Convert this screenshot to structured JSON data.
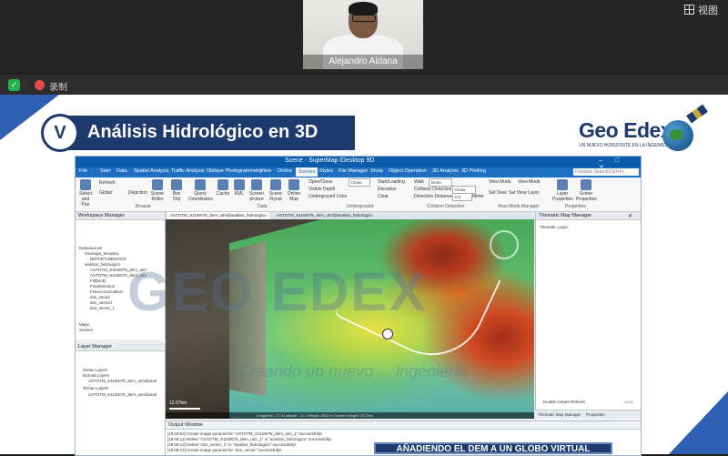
{
  "meeting": {
    "participant_name": "Alejandro Aldana",
    "view_label": "视图",
    "record_label": "录制"
  },
  "slide": {
    "badge": "V",
    "title": "Análisis Hidrológico en 3D",
    "logo": "Geo Edex",
    "tagline": "UN NUEVO HORIZONTE EN LA INGENIERÍA",
    "watermark_logo": "GEO EDEX",
    "watermark_text": "Creando un nuevo ... ingeniería",
    "banner": "AÑADIENDO EL DEM A UN GLOBO VIRTUAL"
  },
  "app": {
    "title": "Scene - SuperMap iDesktop 9D",
    "window_controls": "–  □  ✕",
    "menu": [
      "File",
      "Start",
      "Data",
      "Spatial Analysis",
      "Traffic Analysis",
      "Oblique Photogrammetry",
      "View",
      "Online",
      "Scenes",
      "Styles",
      "File Manager",
      "Show",
      "Object Operation",
      "3D Analysis",
      "3D Plotting"
    ],
    "active_menu_index": 8,
    "search_placeholder": "Function Search(Ctrl+F)",
    "ribbon": {
      "buttons": [
        "Select and Pan",
        "Refresh",
        "Global",
        "Depiction",
        "Scene Roller",
        "Box Clip",
        "Query Coordinates",
        "Cache",
        "KML",
        "Screen picture",
        "Scene Flyout",
        "Online Map",
        "Layer Properties",
        "Scene Properties"
      ],
      "small": [
        "Open/Close",
        "Visible Depth",
        "Underground Color",
        "Start/Loading",
        "Elevation",
        "Clear",
        "Walk",
        "Collision Detection",
        "Detection Distance",
        "View Mode",
        "Set View",
        "View Mode",
        "Set View Layer"
      ],
      "selects": [
        "Close",
        "Close",
        "None",
        "Close",
        "0.5"
      ],
      "groups": [
        "Browse",
        "Data",
        "Underground",
        "Collision Detection",
        "View Mode Manager",
        "Properties"
      ],
      "unit": "Meter"
    },
    "workspace": {
      "header": "Workspace Manager",
      "items": [
        "Datasources",
        "Geologia_tematica",
        "DEPARTAMENTOS",
        "analisis_hidrologico",
        "ASTGTM_S11W078_dem_utm",
        "ASTGTM_S11W078_dem_utm",
        "Fill(Sink)",
        "FlowDirection",
        "FlowAccumulation",
        "dos_vector",
        "dos_vector1",
        "dos_vector_1",
        "Maps",
        "Scenes"
      ]
    },
    "layer_manager": {
      "header": "Layer Manager",
      "items": [
        "Scene Layers",
        "Normal Layers",
        "ASTGTM_S11W078_dem_utm@anal",
        "Terrain Layers",
        "ASTGTM_S11W078_dem_utm@anal"
      ]
    },
    "map_tabs": [
      "ASTGTM_S11W078_dem_utm@analisis_hidrologico",
      "ASTGTM_S11W078_dem_utm@analisis_hidrologico"
    ],
    "map": {
      "scale": "12.67km",
      "status": "Longitude: -77.3   Latitude: -11.1   Height: 3542 m   Camera Height: 15.2 km"
    },
    "thematic": {
      "header": "Thematic Map Manager",
      "layer_label": "Thematic Layer:",
      "instant_refresh": "Enable Instant Refresh",
      "apply": "Apply",
      "tabs": [
        "Thematic Map Manager",
        "Properties"
      ]
    },
    "output": {
      "header": "Output Window",
      "lines": [
        "[19:04:54] Create image pyramid for \"ASTGTM_S11W078_dem_utm_1\" successfully!",
        "[19:08:11] Delete \"ASTGTM_S11W078_dem_utm_1\" in \"analisis_hidrologico\" successfully!",
        "[19:08:12] Delete \"dos_vector_1\" in \"analisis_hidrologico\" successfully!",
        "[19:08:17] Create image pyramid for \"dos_vector\" successfully!"
      ]
    }
  }
}
